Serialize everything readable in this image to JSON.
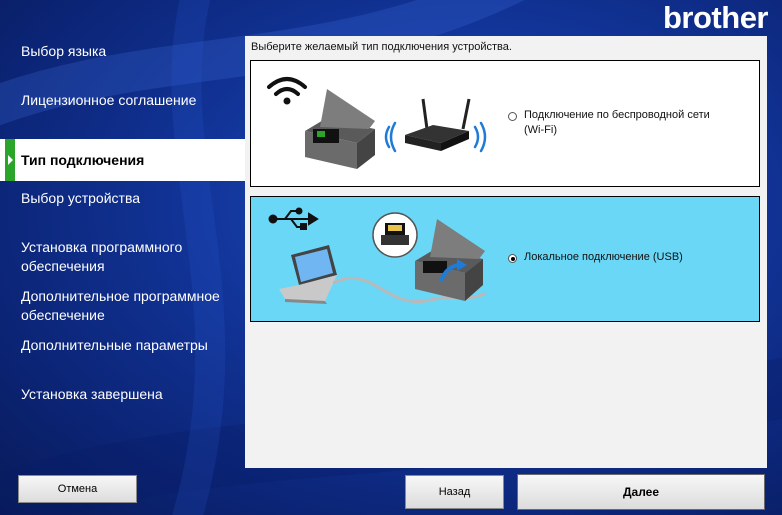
{
  "brand": {
    "logo_text": "brother"
  },
  "sidebar": {
    "items": [
      {
        "label": "Выбор языка"
      },
      {
        "label": "Лицензионное соглашение"
      },
      {
        "label": "Тип подключения"
      },
      {
        "label": "Выбор устройства"
      },
      {
        "label": "Установка программного обеспечения"
      },
      {
        "label": "Дополнительное программное обеспечение"
      },
      {
        "label": "Дополнительные параметры"
      },
      {
        "label": "Установка завершена"
      }
    ],
    "active_index": 2
  },
  "main": {
    "instruction": "Выберите желаемый тип подключения устройства.",
    "options": [
      {
        "label_line1": "Подключение по беспроводной сети",
        "label_line2": "(Wi-Fi)",
        "selected": false,
        "icon": "wifi-printer-router-illustration"
      },
      {
        "label_line1": "Локальное подключение (USB)",
        "label_line2": "",
        "selected": true,
        "icon": "usb-laptop-printer-illustration"
      }
    ]
  },
  "buttons": {
    "cancel": "Отмена",
    "back": "Назад",
    "next": "Далее"
  },
  "colors": {
    "background": "#12359a",
    "selected_option": "#6ad7f7",
    "active_marker": "#2aa52a"
  }
}
